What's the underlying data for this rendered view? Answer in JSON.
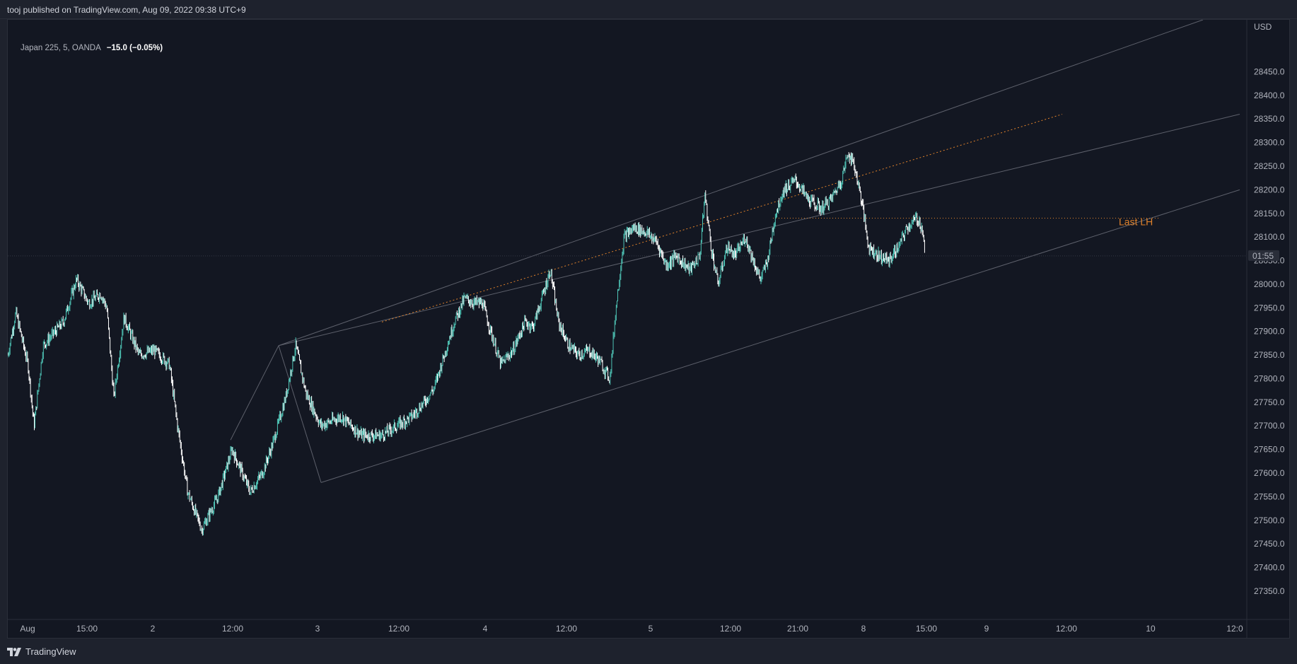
{
  "header": {
    "published": "tooj published on TradingView.com, Aug 09, 2022 09:38 UTC+9"
  },
  "symbol": {
    "info": "Japan 225, 5, OANDA",
    "change": "−15.0 (−0.05%)"
  },
  "price_axis": {
    "currency": "USD",
    "countdown": "01:55"
  },
  "annotation": {
    "last_lh": "Last LH"
  },
  "footer": {
    "brand": "TradingView",
    "logo_icon": "tradingview-logo-icon"
  },
  "colors": {
    "up": "#4ec3b5",
    "down": "#ffffff",
    "channel": "#5d606b",
    "orange": "#e0822b",
    "background": "#131722"
  },
  "chart_data": {
    "type": "candlestick",
    "title": "",
    "ylim": [
      27290,
      28560
    ],
    "y_ticks": [
      27350.0,
      27400.0,
      27450.0,
      27500.0,
      27550.0,
      27600.0,
      27650.0,
      27700.0,
      27750.0,
      27800.0,
      27850.0,
      27900.0,
      27950.0,
      28000.0,
      28050.0,
      28100.0,
      28150.0,
      28200.0,
      28250.0,
      28300.0,
      28350.0,
      28400.0,
      28450.0
    ],
    "x_ticks": [
      "Aug",
      "15:00",
      "2",
      "12:00",
      "3",
      "12:00",
      "4",
      "12:00",
      "5",
      "12:00",
      "21:00",
      "8",
      "15:00",
      "9",
      "12:00",
      "10",
      "12:0"
    ],
    "price_path": [
      [
        0,
        27850
      ],
      [
        8,
        27940
      ],
      [
        20,
        27830
      ],
      [
        26,
        27700
      ],
      [
        35,
        27870
      ],
      [
        55,
        27920
      ],
      [
        68,
        28010
      ],
      [
        80,
        27960
      ],
      [
        92,
        27980
      ],
      [
        98,
        27950
      ],
      [
        105,
        27760
      ],
      [
        115,
        27930
      ],
      [
        130,
        27850
      ],
      [
        145,
        27860
      ],
      [
        160,
        27830
      ],
      [
        168,
        27700
      ],
      [
        178,
        27560
      ],
      [
        192,
        27480
      ],
      [
        208,
        27550
      ],
      [
        222,
        27650
      ],
      [
        240,
        27560
      ],
      [
        252,
        27600
      ],
      [
        262,
        27660
      ],
      [
        275,
        27760
      ],
      [
        285,
        27870
      ],
      [
        295,
        27770
      ],
      [
        310,
        27700
      ],
      [
        330,
        27720
      ],
      [
        350,
        27680
      ],
      [
        370,
        27680
      ],
      [
        385,
        27700
      ],
      [
        400,
        27720
      ],
      [
        412,
        27750
      ],
      [
        422,
        27780
      ],
      [
        432,
        27850
      ],
      [
        442,
        27920
      ],
      [
        452,
        27970
      ],
      [
        462,
        27960
      ],
      [
        470,
        27960
      ],
      [
        478,
        27900
      ],
      [
        488,
        27830
      ],
      [
        500,
        27860
      ],
      [
        512,
        27920
      ],
      [
        520,
        27910
      ],
      [
        530,
        27980
      ],
      [
        537,
        28030
      ],
      [
        545,
        27920
      ],
      [
        555,
        27870
      ],
      [
        565,
        27850
      ],
      [
        575,
        27860
      ],
      [
        585,
        27840
      ],
      [
        596,
        27800
      ],
      [
        602,
        27950
      ],
      [
        610,
        28100
      ],
      [
        620,
        28120
      ],
      [
        632,
        28110
      ],
      [
        642,
        28090
      ],
      [
        652,
        28040
      ],
      [
        662,
        28060
      ],
      [
        675,
        28030
      ],
      [
        685,
        28060
      ],
      [
        690,
        28190
      ],
      [
        696,
        28080
      ],
      [
        703,
        28000
      ],
      [
        712,
        28080
      ],
      [
        720,
        28060
      ],
      [
        730,
        28100
      ],
      [
        738,
        28050
      ],
      [
        745,
        28010
      ],
      [
        752,
        28050
      ],
      [
        760,
        28150
      ],
      [
        768,
        28200
      ],
      [
        780,
        28220
      ],
      [
        792,
        28180
      ],
      [
        805,
        28160
      ],
      [
        815,
        28180
      ],
      [
        825,
        28220
      ],
      [
        832,
        28280
      ],
      [
        838,
        28250
      ],
      [
        845,
        28180
      ],
      [
        852,
        28080
      ],
      [
        862,
        28060
      ],
      [
        872,
        28050
      ],
      [
        882,
        28080
      ],
      [
        890,
        28120
      ],
      [
        900,
        28140
      ],
      [
        905,
        28120
      ],
      [
        908,
        28060
      ]
    ]
  }
}
